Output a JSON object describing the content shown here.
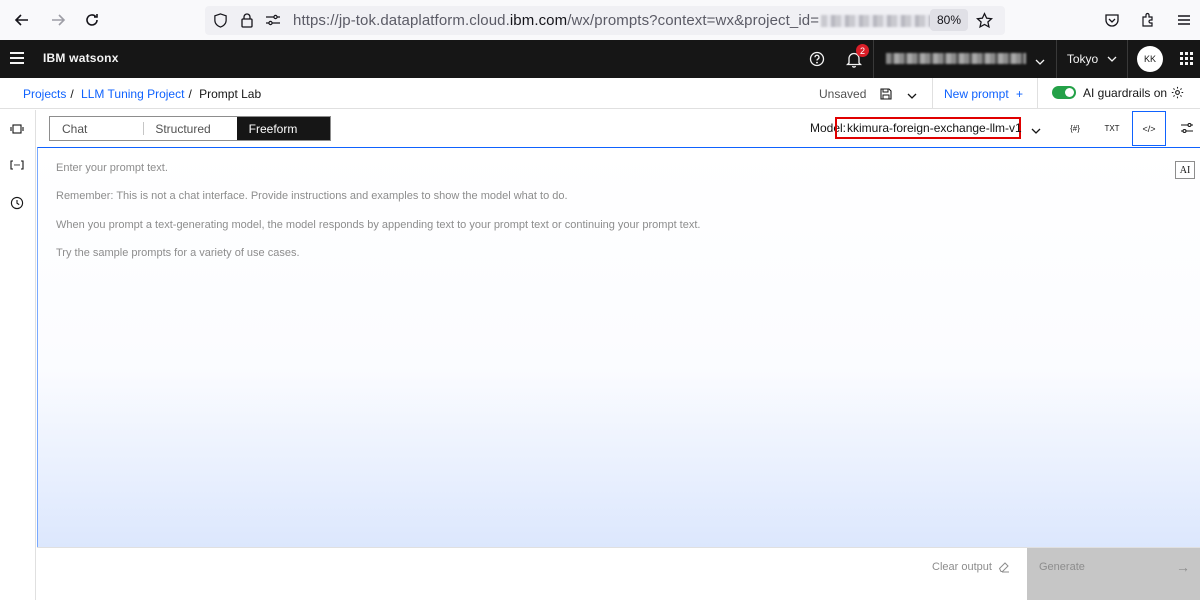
{
  "browser": {
    "url_prefix": "https://jp-tok.dataplatform.cloud.",
    "url_host": "ibm.com",
    "url_path": "/wx/prompts?context=wx&project_id=",
    "zoom": "80%"
  },
  "header": {
    "brand_bold": "IBM",
    "brand_name": "watsonx",
    "notification_count": "2",
    "region": "Tokyo",
    "avatar_initials": "KK"
  },
  "breadcrumb": {
    "items": [
      "Projects",
      "LLM Tuning Project",
      "Prompt Lab"
    ]
  },
  "actions": {
    "save_status": "Unsaved",
    "new_prompt": "New prompt",
    "new_prompt_icon": "+",
    "guardrails": "AI guardrails on"
  },
  "modes": [
    "Chat",
    "Structured",
    "Freeform"
  ],
  "active_mode": "Freeform",
  "model": {
    "label": "Model:",
    "name": "kkimura-foreign-exchange-llm-v1"
  },
  "toolbar": {
    "variables": "{#}",
    "txt": "TXT",
    "code": "</>"
  },
  "editor": {
    "hints": [
      "Enter your prompt text.",
      "Remember: This is not a chat interface. Provide instructions and examples to show the model what to do.",
      "When you prompt a text-generating model, the model responds by appending text to your prompt text or continuing your prompt text.",
      "Try the sample prompts for a variety of use cases."
    ],
    "ai_badge": "AI"
  },
  "footer": {
    "clear_output": "Clear output",
    "generate": "Generate",
    "generate_arrow": "→"
  },
  "colors": {
    "link": "#0f62fe",
    "header_bg": "#161616",
    "toggle_on": "#24a148",
    "highlight": "#e00000"
  }
}
